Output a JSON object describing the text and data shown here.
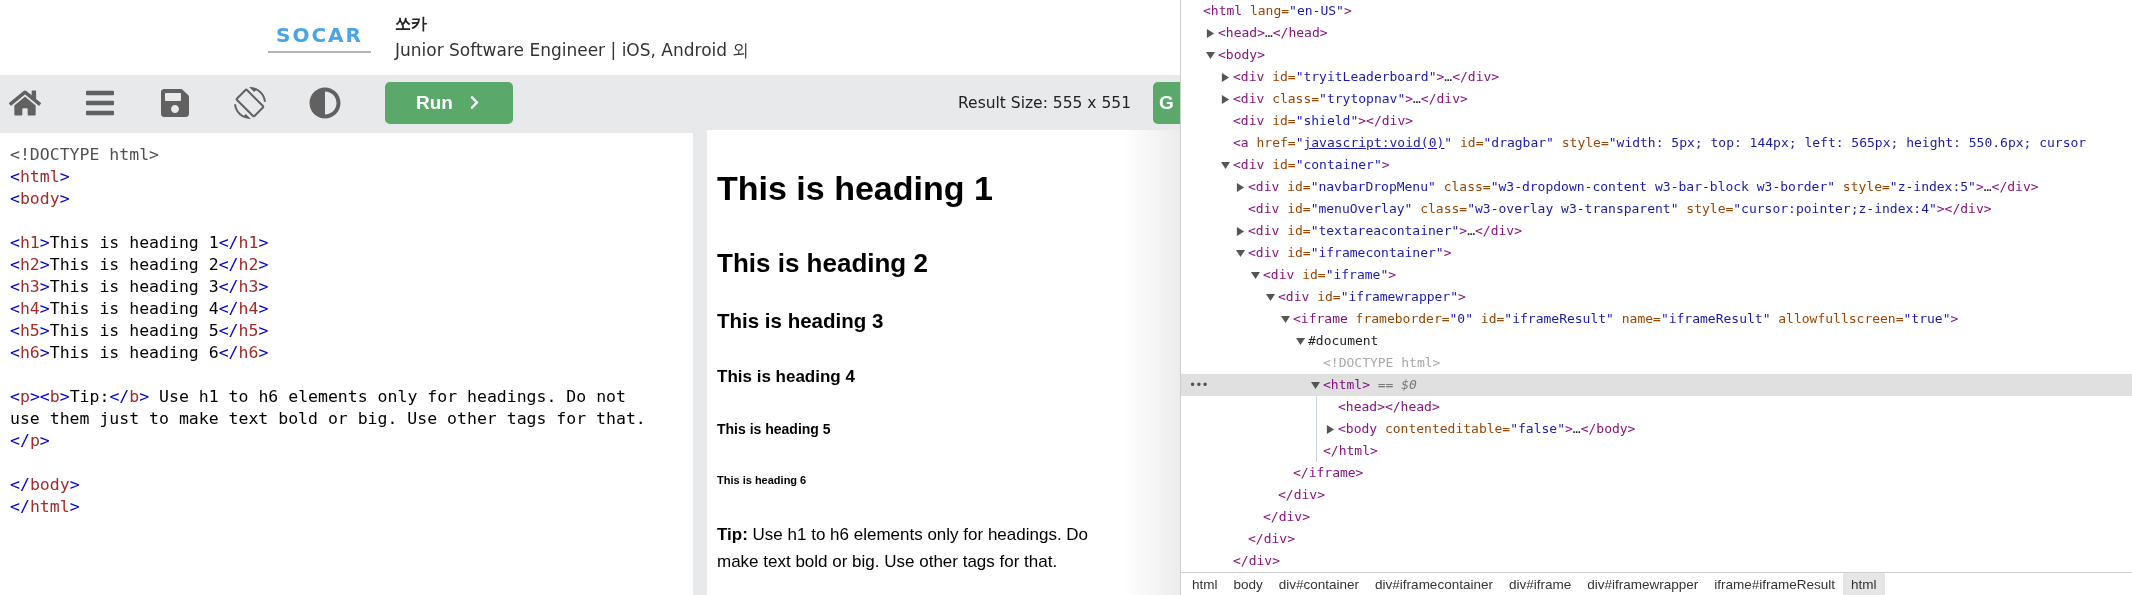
{
  "ad": {
    "logo": "SOCAR",
    "company": "쏘카",
    "job": "Junior Software Engineer | iOS, Android 외"
  },
  "toolbar": {
    "run_label": "Run",
    "result_size": "Result Size: 555 x 551",
    "cut_button": "G"
  },
  "editor": {
    "blocks": [
      [
        [
          {
            "kind": "doctype",
            "text": "<!DOCTYPE html>"
          }
        ],
        [
          {
            "kind": "b",
            "text": "<"
          },
          {
            "kind": "t",
            "text": "html"
          },
          {
            "kind": "b",
            "text": ">"
          }
        ],
        [
          {
            "kind": "b",
            "text": "<"
          },
          {
            "kind": "t",
            "text": "body"
          },
          {
            "kind": "b",
            "text": ">"
          }
        ]
      ],
      [
        [
          {
            "kind": "b",
            "text": "<"
          },
          {
            "kind": "t",
            "text": "h1"
          },
          {
            "kind": "b",
            "text": ">"
          },
          {
            "kind": "x",
            "text": "This is heading 1"
          },
          {
            "kind": "b",
            "text": "</"
          },
          {
            "kind": "t",
            "text": "h1"
          },
          {
            "kind": "b",
            "text": ">"
          }
        ],
        [
          {
            "kind": "b",
            "text": "<"
          },
          {
            "kind": "t",
            "text": "h2"
          },
          {
            "kind": "b",
            "text": ">"
          },
          {
            "kind": "x",
            "text": "This is heading 2"
          },
          {
            "kind": "b",
            "text": "</"
          },
          {
            "kind": "t",
            "text": "h2"
          },
          {
            "kind": "b",
            "text": ">"
          }
        ],
        [
          {
            "kind": "b",
            "text": "<"
          },
          {
            "kind": "t",
            "text": "h3"
          },
          {
            "kind": "b",
            "text": ">"
          },
          {
            "kind": "x",
            "text": "This is heading 3"
          },
          {
            "kind": "b",
            "text": "</"
          },
          {
            "kind": "t",
            "text": "h3"
          },
          {
            "kind": "b",
            "text": ">"
          }
        ],
        [
          {
            "kind": "b",
            "text": "<"
          },
          {
            "kind": "t",
            "text": "h4"
          },
          {
            "kind": "b",
            "text": ">"
          },
          {
            "kind": "x",
            "text": "This is heading 4"
          },
          {
            "kind": "b",
            "text": "</"
          },
          {
            "kind": "t",
            "text": "h4"
          },
          {
            "kind": "b",
            "text": ">"
          }
        ],
        [
          {
            "kind": "b",
            "text": "<"
          },
          {
            "kind": "t",
            "text": "h5"
          },
          {
            "kind": "b",
            "text": ">"
          },
          {
            "kind": "x",
            "text": "This is heading 5"
          },
          {
            "kind": "b",
            "text": "</"
          },
          {
            "kind": "t",
            "text": "h5"
          },
          {
            "kind": "b",
            "text": ">"
          }
        ],
        [
          {
            "kind": "b",
            "text": "<"
          },
          {
            "kind": "t",
            "text": "h6"
          },
          {
            "kind": "b",
            "text": ">"
          },
          {
            "kind": "x",
            "text": "This is heading 6"
          },
          {
            "kind": "b",
            "text": "</"
          },
          {
            "kind": "t",
            "text": "h6"
          },
          {
            "kind": "b",
            "text": ">"
          }
        ]
      ],
      [
        [
          {
            "kind": "b",
            "text": "<"
          },
          {
            "kind": "t",
            "text": "p"
          },
          {
            "kind": "b",
            "text": "><"
          },
          {
            "kind": "t",
            "text": "b"
          },
          {
            "kind": "b",
            "text": ">"
          },
          {
            "kind": "x",
            "text": "Tip:"
          },
          {
            "kind": "b",
            "text": "</"
          },
          {
            "kind": "t",
            "text": "b"
          },
          {
            "kind": "b",
            "text": ">"
          },
          {
            "kind": "x",
            "text": " Use h1 to h6 elements only for headings. Do not"
          }
        ],
        [
          {
            "kind": "x",
            "text": "use them just to make text bold or big. Use other tags for that."
          }
        ],
        [
          {
            "kind": "b",
            "text": "</"
          },
          {
            "kind": "t",
            "text": "p"
          },
          {
            "kind": "b",
            "text": ">"
          }
        ]
      ],
      [
        [
          {
            "kind": "b",
            "text": "</"
          },
          {
            "kind": "t",
            "text": "body"
          },
          {
            "kind": "b",
            "text": ">"
          }
        ],
        [
          {
            "kind": "b",
            "text": "</"
          },
          {
            "kind": "t",
            "text": "html"
          },
          {
            "kind": "b",
            "text": ">"
          }
        ]
      ]
    ]
  },
  "result": {
    "headings": [
      {
        "kind": "h1",
        "text": "This is heading 1"
      },
      {
        "kind": "h2",
        "text": "This is heading 2"
      },
      {
        "kind": "h3",
        "text": "This is heading 3"
      },
      {
        "kind": "h4",
        "text": "This is heading 4"
      },
      {
        "kind": "h5",
        "text": "This is heading 5"
      },
      {
        "kind": "h6",
        "text": "This is heading 6"
      }
    ],
    "tip_lines": [
      "**Tip:** Use h1 to h6 elements only for headings. Do",
      "make text bold or big. Use other tags for that."
    ]
  },
  "devtools": {
    "selected_row_marker": "•••",
    "tree": [
      {
        "selected": false,
        "parts": [
          {
            "kind": "tag",
            "text": "<html"
          },
          {
            "kind": "attr",
            "text": " lang="
          },
          {
            "kind": "value",
            "text": "\"en-US\""
          },
          {
            "kind": "tag",
            "text": ">"
          }
        ],
        "children": [
          {
            "selected": false,
            "expanded": false,
            "parts": [
              {
                "kind": "tag",
                "text": "<head>"
              },
              {
                "kind": "text",
                "text": "…"
              },
              {
                "kind": "tag",
                "text": "</head>"
              }
            ]
          },
          {
            "selected": false,
            "expanded": true,
            "parts": [
              {
                "kind": "tag",
                "text": "<body>"
              }
            ],
            "children": [
              {
                "selected": false,
                "expanded": false,
                "parts": [
                  {
                    "kind": "tag",
                    "text": "<div"
                  },
                  {
                    "kind": "attr",
                    "text": " id="
                  },
                  {
                    "kind": "value",
                    "text": "\"tryitLeaderboard\""
                  },
                  {
                    "kind": "tag",
                    "text": ">"
                  },
                  {
                    "kind": "text",
                    "text": "…"
                  },
                  {
                    "kind": "tag",
                    "text": "</div>"
                  }
                ]
              },
              {
                "selected": false,
                "expanded": false,
                "parts": [
                  {
                    "kind": "tag",
                    "text": "<div"
                  },
                  {
                    "kind": "attr",
                    "text": " class="
                  },
                  {
                    "kind": "value",
                    "text": "\"trytopnav\""
                  },
                  {
                    "kind": "tag",
                    "text": ">"
                  },
                  {
                    "kind": "text",
                    "text": "…"
                  },
                  {
                    "kind": "tag",
                    "text": "</div>"
                  }
                ]
              },
              {
                "selected": false,
                "parts": [
                  {
                    "kind": "tag",
                    "text": "<div"
                  },
                  {
                    "kind": "attr",
                    "text": " id="
                  },
                  {
                    "kind": "value",
                    "text": "\"shield\""
                  },
                  {
                    "kind": "tag",
                    "text": "></div>"
                  }
                ]
              },
              {
                "selected": false,
                "parts": [
                  {
                    "kind": "tag",
                    "text": "<a"
                  },
                  {
                    "kind": "attr",
                    "text": " href="
                  },
                  {
                    "kind": "value",
                    "text": "\""
                  },
                  {
                    "kind": "link",
                    "text": "javascript:void(0)"
                  },
                  {
                    "kind": "value",
                    "text": "\""
                  },
                  {
                    "kind": "attr",
                    "text": " id="
                  },
                  {
                    "kind": "value",
                    "text": "\"dragbar\""
                  },
                  {
                    "kind": "attr",
                    "text": " style="
                  },
                  {
                    "kind": "value",
                    "text": "\"width: 5px; top: 144px; left: 565px; height: 550.6px; cursor"
                  }
                ]
              },
              {
                "selected": false,
                "expanded": true,
                "parts": [
                  {
                    "kind": "tag",
                    "text": "<div"
                  },
                  {
                    "kind": "attr",
                    "text": " id="
                  },
                  {
                    "kind": "value",
                    "text": "\"container\""
                  },
                  {
                    "kind": "tag",
                    "text": ">"
                  }
                ],
                "children": [
                  {
                    "selected": false,
                    "expanded": false,
                    "parts": [
                      {
                        "kind": "tag",
                        "text": "<div"
                      },
                      {
                        "kind": "attr",
                        "text": " id="
                      },
                      {
                        "kind": "value",
                        "text": "\"navbarDropMenu\""
                      },
                      {
                        "kind": "attr",
                        "text": " class="
                      },
                      {
                        "kind": "value",
                        "text": "\"w3-dropdown-content w3-bar-block w3-border\""
                      },
                      {
                        "kind": "attr",
                        "text": " style="
                      },
                      {
                        "kind": "value",
                        "text": "\"z-index:5\""
                      },
                      {
                        "kind": "tag",
                        "text": ">"
                      },
                      {
                        "kind": "text",
                        "text": "…"
                      },
                      {
                        "kind": "tag",
                        "text": "</div>"
                      }
                    ]
                  },
                  {
                    "selected": false,
                    "parts": [
                      {
                        "kind": "tag",
                        "text": "<div"
                      },
                      {
                        "kind": "attr",
                        "text": " id="
                      },
                      {
                        "kind": "value",
                        "text": "\"menuOverlay\""
                      },
                      {
                        "kind": "attr",
                        "text": " class="
                      },
                      {
                        "kind": "value",
                        "text": "\"w3-overlay w3-transparent\""
                      },
                      {
                        "kind": "attr",
                        "text": " style="
                      },
                      {
                        "kind": "value",
                        "text": "\"cursor:pointer;z-index:4\""
                      },
                      {
                        "kind": "tag",
                        "text": "></div>"
                      }
                    ]
                  },
                  {
                    "selected": false,
                    "expanded": false,
                    "parts": [
                      {
                        "kind": "tag",
                        "text": "<div"
                      },
                      {
                        "kind": "attr",
                        "text": " id="
                      },
                      {
                        "kind": "value",
                        "text": "\"textareacontainer\""
                      },
                      {
                        "kind": "tag",
                        "text": ">"
                      },
                      {
                        "kind": "text",
                        "text": "…"
                      },
                      {
                        "kind": "tag",
                        "text": "</div>"
                      }
                    ]
                  },
                  {
                    "selected": false,
                    "expanded": true,
                    "parts": [
                      {
                        "kind": "tag",
                        "text": "<div"
                      },
                      {
                        "kind": "attr",
                        "text": " id="
                      },
                      {
                        "kind": "value",
                        "text": "\"iframecontainer\""
                      },
                      {
                        "kind": "tag",
                        "text": ">"
                      }
                    ],
                    "children": [
                      {
                        "selected": false,
                        "expanded": true,
                        "parts": [
                          {
                            "kind": "tag",
                            "text": "<div"
                          },
                          {
                            "kind": "attr",
                            "text": " id="
                          },
                          {
                            "kind": "value",
                            "text": "\"iframe\""
                          },
                          {
                            "kind": "tag",
                            "text": ">"
                          }
                        ],
                        "children": [
                          {
                            "selected": false,
                            "expanded": true,
                            "parts": [
                              {
                                "kind": "tag",
                                "text": "<div"
                              },
                              {
                                "kind": "attr",
                                "text": " id="
                              },
                              {
                                "kind": "value",
                                "text": "\"iframewrapper\""
                              },
                              {
                                "kind": "tag",
                                "text": ">"
                              }
                            ],
                            "children": [
                              {
                                "selected": false,
                                "expanded": true,
                                "parts": [
                                  {
                                    "kind": "tag",
                                    "text": "<iframe"
                                  },
                                  {
                                    "kind": "attr",
                                    "text": " frameborder="
                                  },
                                  {
                                    "kind": "value",
                                    "text": "\"0\""
                                  },
                                  {
                                    "kind": "attr",
                                    "text": " id="
                                  },
                                  {
                                    "kind": "value",
                                    "text": "\"iframeResult\""
                                  },
                                  {
                                    "kind": "attr",
                                    "text": " name="
                                  },
                                  {
                                    "kind": "value",
                                    "text": "\"iframeResult\""
                                  },
                                  {
                                    "kind": "attr",
                                    "text": " allowfullscreen="
                                  },
                                  {
                                    "kind": "value",
                                    "text": "\"true\""
                                  },
                                  {
                                    "kind": "tag",
                                    "text": ">"
                                  }
                                ],
                                "children": [
                                  {
                                    "selected": false,
                                    "expanded": true,
                                    "parts": [
                                      {
                                        "kind": "text",
                                        "text": "#document"
                                      }
                                    ],
                                    "children": [
                                      {
                                        "selected": false,
                                        "parts": [
                                          {
                                            "kind": "comment",
                                            "text": "<!DOCTYPE html>"
                                          }
                                        ]
                                      },
                                      {
                                        "selected": true,
                                        "expanded": true,
                                        "parts": [
                                          {
                                            "kind": "tag",
                                            "text": "<html>"
                                          },
                                          {
                                            "kind": "note",
                                            "text": " == $0"
                                          }
                                        ],
                                        "children": [
                                          {
                                            "selected": false,
                                            "parts": [
                                              {
                                                "kind": "tag",
                                                "text": "<head></head>"
                                              }
                                            ]
                                          },
                                          {
                                            "selected": false,
                                            "expanded": false,
                                            "parts": [
                                              {
                                                "kind": "tag",
                                                "text": "<body"
                                              },
                                              {
                                                "kind": "attr",
                                                "text": " contenteditable="
                                              },
                                              {
                                                "kind": "value",
                                                "text": "\"false\""
                                              },
                                              {
                                                "kind": "tag",
                                                "text": ">"
                                              },
                                              {
                                                "kind": "text",
                                                "text": "…"
                                              },
                                              {
                                                "kind": "tag",
                                                "text": "</body>"
                                              }
                                            ]
                                          }
                                        ],
                                        "close": [
                                          {
                                            "kind": "tag",
                                            "text": "</html>"
                                          }
                                        ]
                                      }
                                    ]
                                  }
                                ],
                                "close": [
                                  {
                                    "kind": "tag",
                                    "text": "</iframe>"
                                  }
                                ]
                              }
                            ],
                            "close": [
                              {
                                "kind": "tag",
                                "text": "</div>"
                              }
                            ]
                          }
                        ],
                        "close": [
                          {
                            "kind": "tag",
                            "text": "</div>"
                          }
                        ]
                      }
                    ],
                    "close": [
                      {
                        "kind": "tag",
                        "text": "</div>"
                      }
                    ]
                  }
                ],
                "close": [
                  {
                    "kind": "tag",
                    "text": "</div>"
                  }
                ]
              }
            ]
          }
        ]
      }
    ],
    "breadcrumbs": [
      {
        "label": "html",
        "selected": false
      },
      {
        "label": "body",
        "selected": false
      },
      {
        "label": "div#container",
        "selected": false
      },
      {
        "label": "div#iframecontainer",
        "selected": false
      },
      {
        "label": "div#iframe",
        "selected": false
      },
      {
        "label": "div#iframewrapper",
        "selected": false
      },
      {
        "label": "iframe#iframeResult",
        "selected": false
      },
      {
        "label": "html",
        "selected": true
      }
    ]
  }
}
